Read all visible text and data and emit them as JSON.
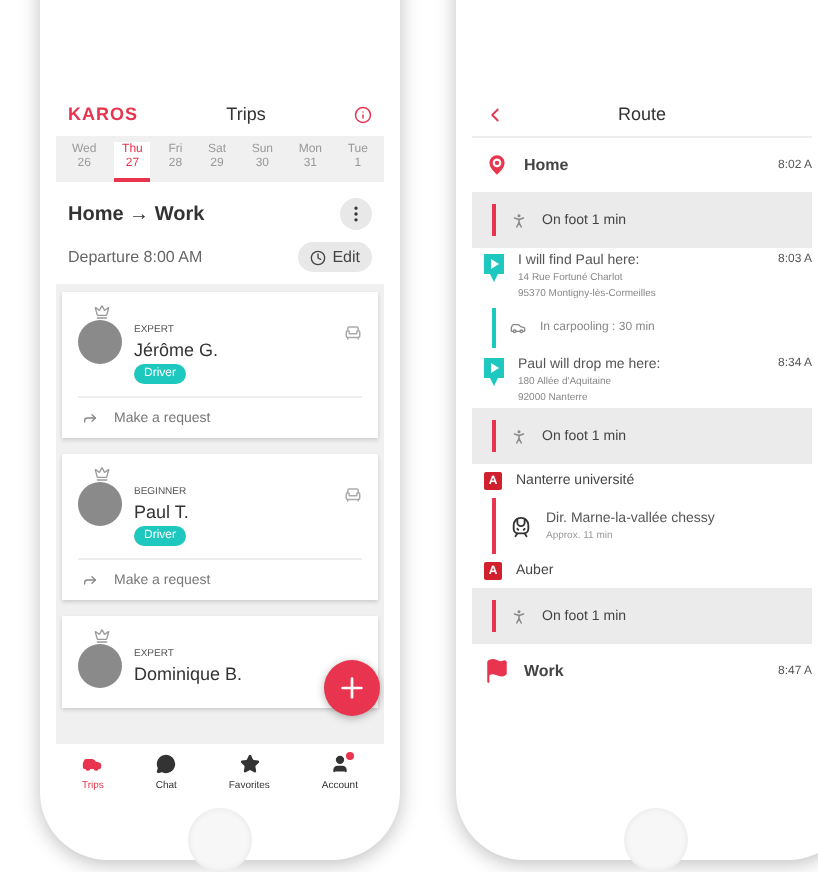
{
  "trips_screen": {
    "brand": "KAROS",
    "title": "Trips",
    "days": [
      {
        "weekday": "Wed",
        "date": "26",
        "selected": false
      },
      {
        "weekday": "Thu",
        "date": "27",
        "selected": true
      },
      {
        "weekday": "Fri",
        "date": "28",
        "selected": false
      },
      {
        "weekday": "Sat",
        "date": "29",
        "selected": false
      },
      {
        "weekday": "Sun",
        "date": "30",
        "selected": false
      },
      {
        "weekday": "Mon",
        "date": "31",
        "selected": false
      },
      {
        "weekday": "Tue",
        "date": "1",
        "selected": false
      }
    ],
    "trip_title": "Home → Work",
    "departure": "Departure 8:00 AM",
    "edit_button": "Edit",
    "drivers": [
      {
        "level": "EXPERT",
        "name": "Jérôme G.",
        "role": "Driver",
        "action": "Make a request"
      },
      {
        "level": "BEGINNER",
        "name": "Paul T.",
        "role": "Driver",
        "action": "Make a request"
      },
      {
        "level": "EXPERT",
        "name": "Dominique B."
      }
    ],
    "tabs": [
      {
        "label": "Trips",
        "selected": true,
        "notification": false
      },
      {
        "label": "Chat",
        "selected": false,
        "notification": false
      },
      {
        "label": "Favorites",
        "selected": false,
        "notification": false
      },
      {
        "label": "Account",
        "selected": false,
        "notification": true
      }
    ]
  },
  "route_screen": {
    "title": "Route",
    "steps": [
      {
        "kind": "start",
        "label": "Home",
        "time": "8:02 A"
      },
      {
        "kind": "walk",
        "label": "On foot 1 min"
      },
      {
        "kind": "meet",
        "label": "I will find Paul here:",
        "address": [
          "14 Rue Fortuné Charlot",
          "95370 Montigny-lès-Cormeilles"
        ],
        "time": "8:03 A"
      },
      {
        "kind": "carpool",
        "label": "In carpooling : 30 min"
      },
      {
        "kind": "meet",
        "label": "Paul will drop me here:",
        "address": [
          "180 Allée d'Aquitaine",
          "92000 Nanterre"
        ],
        "time": "8:34 A"
      },
      {
        "kind": "walk",
        "label": "On foot 1 min"
      },
      {
        "kind": "station",
        "label": "Nanterre université",
        "badge": "A"
      },
      {
        "kind": "transit",
        "label": "Dir. Marne-la-vallée chessy",
        "detail": "Approx. 11 min"
      },
      {
        "kind": "station",
        "label": "Auber",
        "badge": "A"
      },
      {
        "kind": "walk",
        "label": "On foot 1 min"
      },
      {
        "kind": "end",
        "label": "Work",
        "time": "8:47 A"
      }
    ]
  }
}
